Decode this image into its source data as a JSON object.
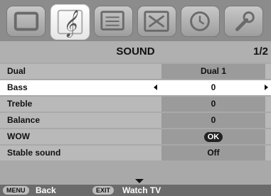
{
  "menu": {
    "title": "SOUND",
    "page_indicator": "1/2"
  },
  "tabs": [
    {
      "name": "picture-menu-icon",
      "active": false
    },
    {
      "name": "sound-menu-icon",
      "active": true
    },
    {
      "name": "features-menu-icon",
      "active": false
    },
    {
      "name": "setup-menu-icon",
      "active": false
    },
    {
      "name": "timer-menu-icon",
      "active": false
    },
    {
      "name": "installation-menu-icon",
      "active": false
    }
  ],
  "rows": [
    {
      "label": "Dual",
      "value": "Dual 1"
    },
    {
      "label": "Bass",
      "value": "0",
      "selected": true
    },
    {
      "label": "Treble",
      "value": "0"
    },
    {
      "label": "Balance",
      "value": "0"
    },
    {
      "label": "WOW",
      "value": "OK"
    },
    {
      "label": "Stable sound",
      "value": "Off"
    }
  ],
  "footer": {
    "menu_key": "MENU",
    "menu_action": "Back",
    "exit_key": "EXIT",
    "exit_action": "Watch TV"
  }
}
